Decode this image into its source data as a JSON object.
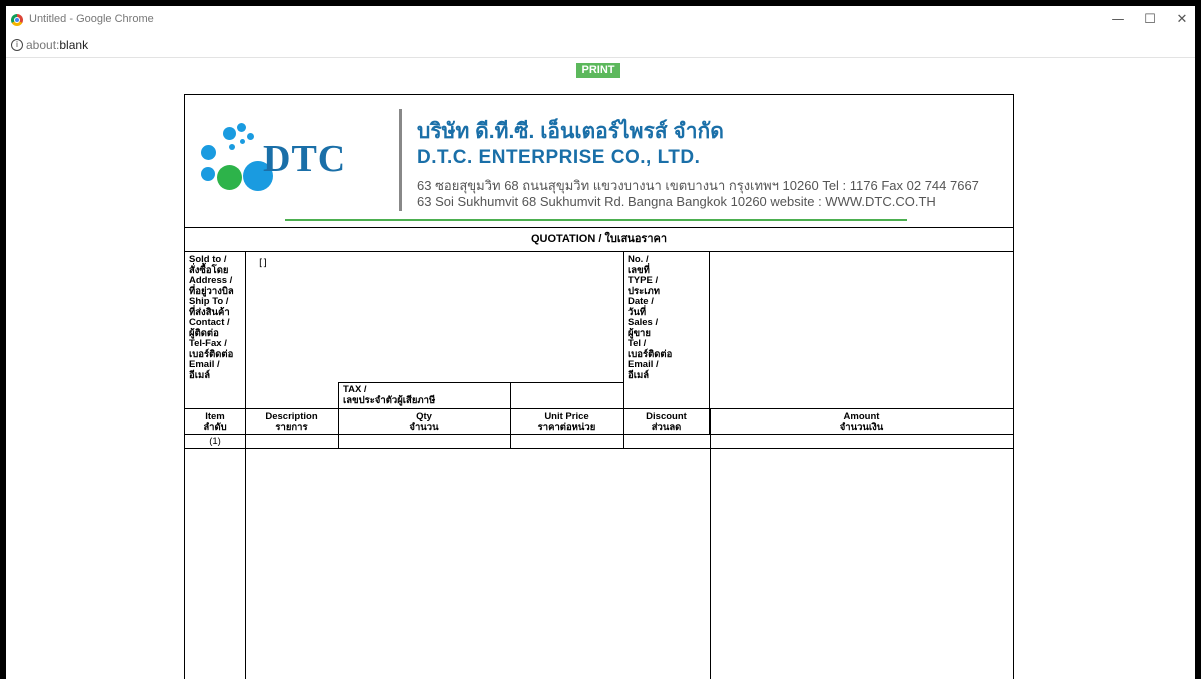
{
  "window": {
    "title": "Untitled - Google Chrome",
    "minimize": "—",
    "maximize": "☐",
    "close": "✕"
  },
  "address": {
    "prefix": "about:",
    "suffix": "blank"
  },
  "toolbar": {
    "print_label": "PRINT"
  },
  "company": {
    "logo_text": "DTC",
    "name_thai": "บริษัท ดี.ที.ซี. เอ็นเตอร์ไพรส์ จำกัด",
    "name_en": "D.T.C. ENTERPRISE CO., LTD.",
    "address_thai": "63 ซอยสุขุมวิท 68 ถนนสุขุมวิท แขวงบางนา เขตบางนา กรุงเทพฯ 10260  Tel : 1176  Fax 02 744 7667",
    "address_en": "63 Soi Sukhumvit 68 Sukhumvit Rd. Bangna Bangkok 10260  website : WWW.DTC.CO.TH",
    "colors": {
      "logo_blue": "#1a9be0",
      "logo_green": "#2db34a",
      "text_blue": "#1a6fa8",
      "rule_green": "#4caf50"
    }
  },
  "form": {
    "title": "QUOTATION / ใบเสนอราคา",
    "left_labels": [
      "Sold to /",
      "สั่งซื้อโดย",
      "Address /",
      "ที่อยู่วางบิล",
      "Ship To /",
      "ที่ส่งสินค้า",
      "Contact /",
      "ผู้ติดต่อ",
      "Tel-Fax /",
      "เบอร์ติดต่อ",
      "Email /",
      "อีเมล์"
    ],
    "tax_label": [
      "TAX /",
      "เลขประจำตัวผู้เสียภาษี"
    ],
    "right_labels": [
      "No. /",
      "เลขที่",
      "TYPE /",
      "ประเภท",
      "Date /",
      "วันที่",
      "Sales /",
      "ผู้ขาย",
      "Tel /",
      "เบอร์ติดต่อ",
      "Email /",
      "อีเมล์"
    ],
    "sold_to_value": "[]",
    "columns": [
      {
        "en": "Item",
        "th": "ลำดับ"
      },
      {
        "en": "Description",
        "th": "รายการ"
      },
      {
        "en": "Qty",
        "th": "จำนวน"
      },
      {
        "en": "Unit Price",
        "th": "ราคาต่อหน่วย"
      },
      {
        "en": "Discount",
        "th": "ส่วนลด"
      },
      {
        "en": "Amount",
        "th": "จำนวนเงิน"
      }
    ],
    "rows": [
      {
        "item": "(1)"
      }
    ]
  }
}
